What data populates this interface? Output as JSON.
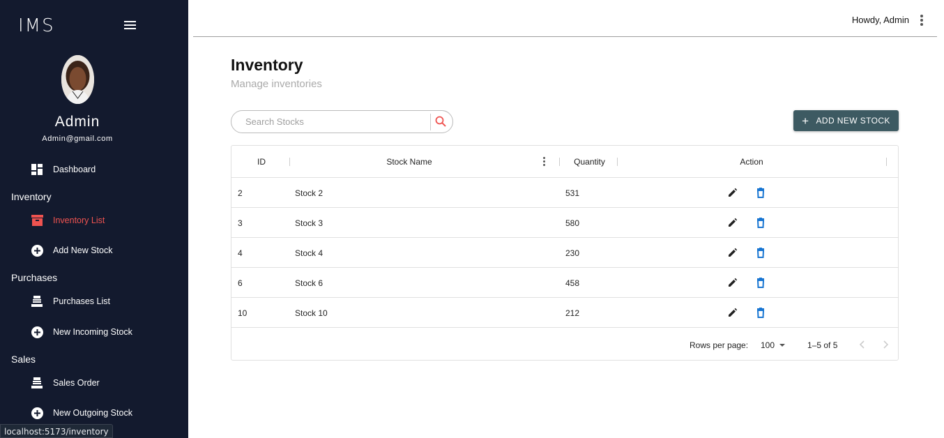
{
  "app": {
    "logo": "IMS"
  },
  "profile": {
    "name": "Admin",
    "email": "Admin@gmail.com"
  },
  "sidebar": {
    "dashboard": "Dashboard",
    "sections": {
      "inventory": "Inventory",
      "purchases": "Purchases",
      "sales": "Sales"
    },
    "items": {
      "inventory_list": "Inventory List",
      "add_new_stock": "Add New Stock",
      "purchases_list": "Purchases List",
      "new_incoming_stock": "New Incoming Stock",
      "sales_order": "Sales Order",
      "new_outgoing_stock": "New Outgoing Stock"
    },
    "active_color": "#ef5350",
    "background": "#131a2e"
  },
  "header": {
    "greeting": "Howdy, Admin"
  },
  "page": {
    "title": "Inventory",
    "subtitle": "Manage inventories"
  },
  "search": {
    "placeholder": "Search Stocks"
  },
  "add_button": {
    "label": "ADD NEW STOCK",
    "color": "#3d5a62"
  },
  "table": {
    "columns": [
      "ID",
      "Stock Name",
      "Quantity",
      "Action"
    ],
    "rows": [
      {
        "id": "2",
        "name": "Stock 2",
        "quantity": "531"
      },
      {
        "id": "3",
        "name": "Stock 3",
        "quantity": "580"
      },
      {
        "id": "4",
        "name": "Stock 4",
        "quantity": "230"
      },
      {
        "id": "6",
        "name": "Stock 6",
        "quantity": "458"
      },
      {
        "id": "10",
        "name": "Stock 10",
        "quantity": "212"
      }
    ],
    "actions": {
      "edit_icon": "pencil-icon",
      "delete_icon": "trash-icon",
      "delete_color": "#1976d2"
    }
  },
  "pagination": {
    "rows_per_page_label": "Rows per page:",
    "rows_per_page": "100",
    "range": "1–5 of 5"
  },
  "status_bar": {
    "url": "localhost:5173/inventory"
  }
}
